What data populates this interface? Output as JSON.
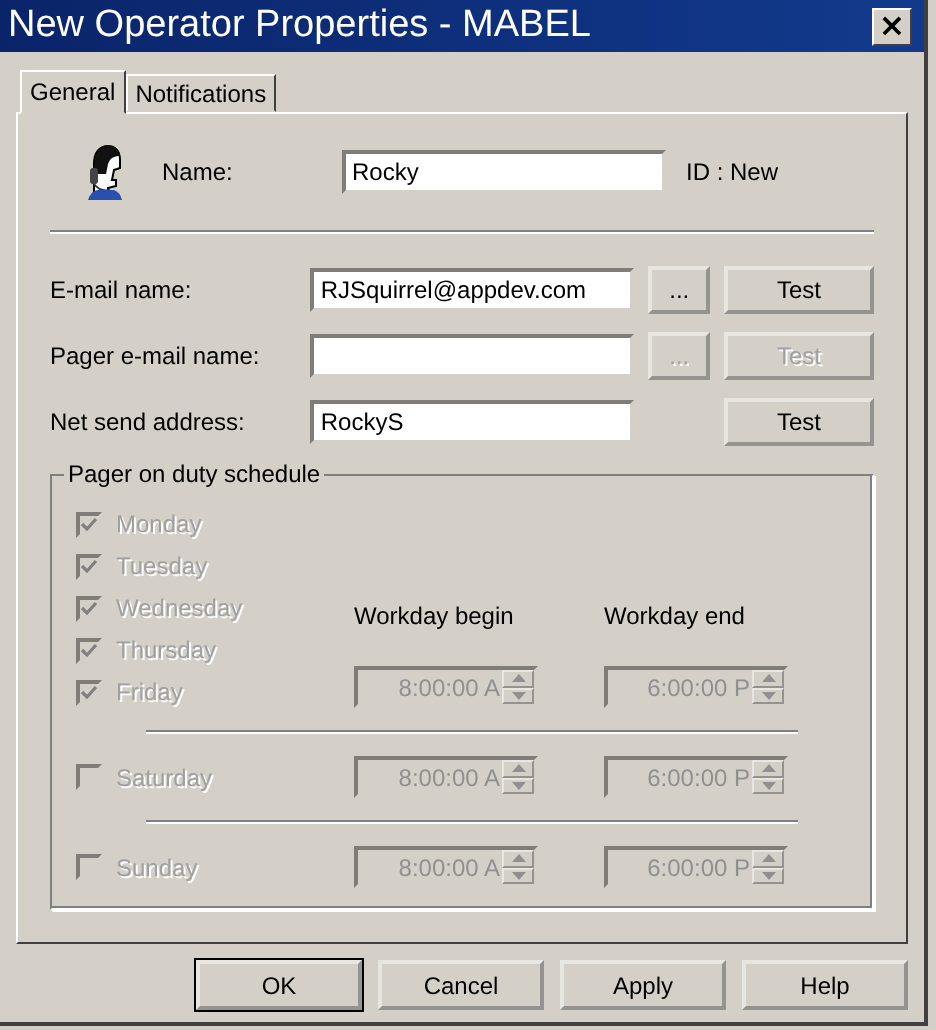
{
  "window": {
    "title": "New Operator Properties - MABEL",
    "close": "×"
  },
  "tabs": [
    {
      "label": "General",
      "selected": true
    },
    {
      "label": "Notifications",
      "selected": false
    }
  ],
  "name_row": {
    "label": "Name:",
    "value": "Rocky",
    "id_text": "ID : New"
  },
  "fields": [
    {
      "label": "E-mail name:",
      "value": "RJSquirrel@appdev.com",
      "browse": "...",
      "test": "Test",
      "disabled": false
    },
    {
      "label": "Pager e-mail name:",
      "browse": "...",
      "test": "Test",
      "disabled": true
    },
    {
      "label": "Net send address:",
      "value": "RockyS",
      "test": "Test",
      "disabled": false
    }
  ],
  "schedule": {
    "title": "Pager on duty schedule",
    "disabled": true,
    "begin_label": "Workday begin",
    "end_label": "Workday end",
    "weekdays": [
      {
        "label": "Monday",
        "checked": true
      },
      {
        "label": "Tuesday",
        "checked": true
      },
      {
        "label": "Wednesday",
        "checked": true
      },
      {
        "label": "Thursday",
        "checked": true
      },
      {
        "label": "Friday",
        "checked": true
      }
    ],
    "weekday_begin": "8:00:00 A",
    "weekday_end": "6:00:00 P",
    "weekend": [
      {
        "label": "Saturday",
        "checked": false,
        "begin": "8:00:00 A",
        "end": "6:00:00 P"
      },
      {
        "label": "Sunday",
        "checked": false,
        "begin": "8:00:00 A",
        "end": "6:00:00 P"
      }
    ]
  },
  "buttons": [
    "OK",
    "Cancel",
    "Apply",
    "Help"
  ]
}
